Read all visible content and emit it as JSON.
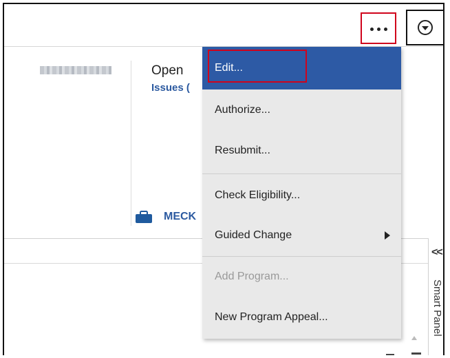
{
  "toolbar": {
    "more_icon": "overflow-dots-icon",
    "collapse_icon": "circle-chevron-down-icon",
    "accent_highlight": "#d0021b"
  },
  "summary": {
    "status_label": "Open",
    "issues_link": "Issues (",
    "program_label": "MECK"
  },
  "menu": {
    "items": [
      {
        "label": "Edit...",
        "state": "active"
      },
      {
        "label": "Authorize...",
        "state": "normal"
      },
      {
        "label": "Resubmit...",
        "state": "normal"
      },
      {
        "label": "Check Eligibility...",
        "state": "normal"
      },
      {
        "label": "Guided Change",
        "state": "normal",
        "has_submenu": true
      },
      {
        "label": "Add Program...",
        "state": "disabled"
      },
      {
        "label": "New Program Appeal...",
        "state": "normal"
      }
    ],
    "active_color": "#2d5aa5"
  },
  "smart_panel": {
    "expand_glyph": "<<",
    "label": "Smart Panel"
  }
}
